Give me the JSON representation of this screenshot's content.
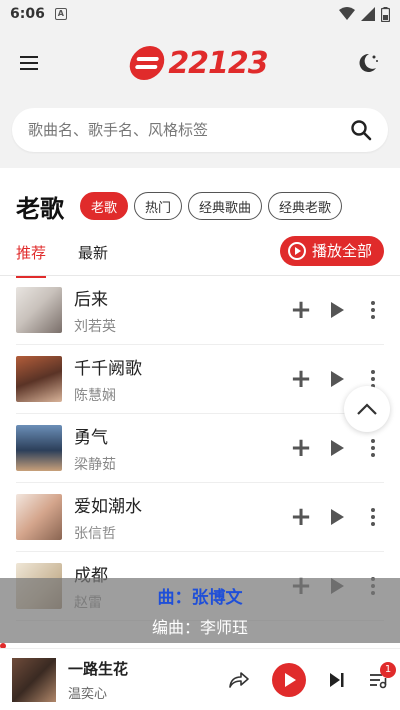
{
  "status_bar": {
    "time": "6:06",
    "sim_label": "A"
  },
  "header": {
    "logo_text": "22123"
  },
  "search": {
    "placeholder": "歌曲名、歌手名、风格标签"
  },
  "section": {
    "title": "老歌",
    "chips": [
      {
        "label": "老歌",
        "active": true
      },
      {
        "label": "热门",
        "active": false
      },
      {
        "label": "经典歌曲",
        "active": false
      },
      {
        "label": "经典老歌",
        "active": false
      }
    ]
  },
  "tabs": [
    {
      "label": "推荐",
      "active": true
    },
    {
      "label": "最新",
      "active": false
    }
  ],
  "play_all_label": "播放全部",
  "songs": [
    {
      "title": "后来",
      "artist": "刘若英"
    },
    {
      "title": "千千阙歌",
      "artist": "陈慧娴"
    },
    {
      "title": "勇气",
      "artist": "梁静茹"
    },
    {
      "title": "爱如潮水",
      "artist": "张信哲"
    },
    {
      "title": "成都",
      "artist": "赵雷"
    }
  ],
  "lyrics": {
    "line1": "曲：张博文",
    "line2": "编曲：李师珏"
  },
  "player": {
    "title": "一路生花",
    "artist": "温奕心",
    "queue_count": "1"
  },
  "colors": {
    "accent": "#e02b2b",
    "lyric_highlight": "#1f4fd8"
  }
}
